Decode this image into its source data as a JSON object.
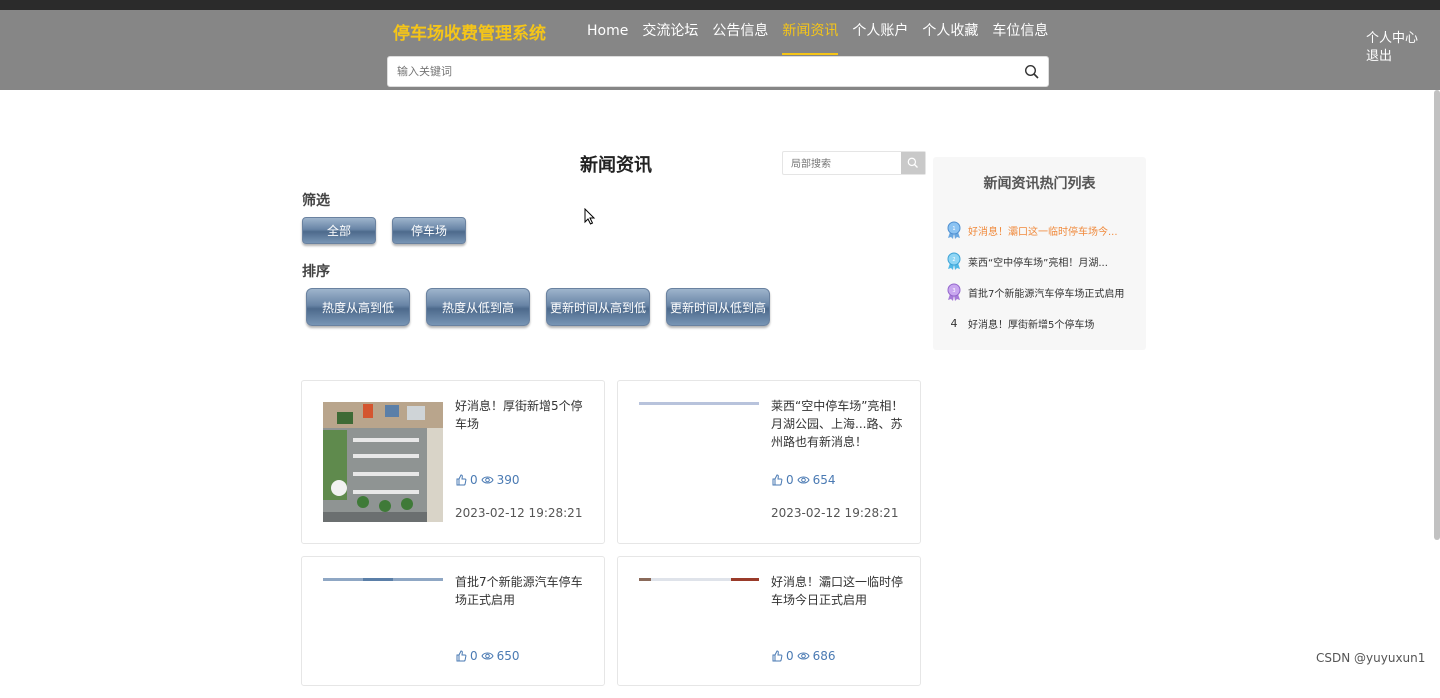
{
  "header": {
    "brand": "停车场收费管理系统",
    "nav": [
      "Home",
      "交流论坛",
      "公告信息",
      "新闻资讯",
      "个人账户",
      "个人收藏",
      "车位信息"
    ],
    "active_nav": "新闻资讯",
    "user_center": "个人中心",
    "logout": "退出",
    "search_placeholder": "输入关键词",
    "search_icon": "search-icon"
  },
  "main": {
    "title": "新闻资讯",
    "local_search_placeholder": "局部搜索",
    "filter_label": "筛选",
    "filters": [
      "全部",
      "停车场"
    ],
    "sort_label": "排序",
    "sorts": [
      "热度从高到低",
      "热度从低到高",
      "更新时间从高到低",
      "更新时间从低到高"
    ],
    "cards": [
      {
        "title": "好消息！厚街新增5个停车场",
        "likes": "0",
        "views": "390",
        "date": "2023-02-12 19:28:21"
      },
      {
        "title": "莱西“空中停车场”亮相！月湖公园、上海...路、苏州路也有新消息！",
        "likes": "0",
        "views": "654",
        "date": "2023-02-12 19:28:21"
      },
      {
        "title": "首批7个新能源汽车停车场正式启用",
        "likes": "0",
        "views": "650",
        "date": ""
      },
      {
        "title": "好消息！灞口这一临时停车场今日正式启用",
        "likes": "0",
        "views": "686",
        "date": ""
      }
    ]
  },
  "hot": {
    "title": "新闻资讯热门列表",
    "items": [
      {
        "rank": "1",
        "text": "好消息！灞口这一临时停车场今..."
      },
      {
        "rank": "2",
        "text": "莱西“空中停车场”亮相！月湖..."
      },
      {
        "rank": "3",
        "text": "首批7个新能源汽车停车场正式启用"
      },
      {
        "rank": "4",
        "text": "好消息！厚街新增5个停车场"
      }
    ]
  },
  "watermark": "CSDN @yuyuxun1",
  "colors": {
    "accent": "#f5c518",
    "header_bg": "#868686",
    "link_blue": "#4a7ab3",
    "hot_first": "#f08a3c"
  }
}
